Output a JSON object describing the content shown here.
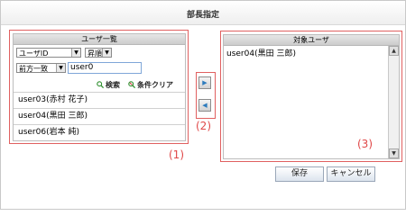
{
  "window": {
    "title": "部長指定"
  },
  "user_list": {
    "header": "ユーザ一覧",
    "sort_field": "ユーザID",
    "sort_order": "昇順",
    "match_mode": "前方一致",
    "search_value": "user0",
    "search_button": "検索",
    "clear_button": "条件クリア",
    "users": [
      "user03(赤村 花子)",
      "user04(黒田 三郎)",
      "user06(岩本 純)"
    ]
  },
  "target_list": {
    "header": "対象ユーザ",
    "users": [
      "user04(黒田 三郎)"
    ]
  },
  "annotations": {
    "left": "(1)",
    "middle": "(2)",
    "right": "(3)"
  },
  "buttons": {
    "save": "保存",
    "cancel": "キャンセル"
  },
  "colors": {
    "annotation": "#e04848",
    "arrow": "#2d7bbd"
  },
  "icons": {
    "add": "arrow-right-icon",
    "remove": "arrow-left-icon",
    "search": "magnifier-icon",
    "clear": "magnifier-clear-icon"
  }
}
